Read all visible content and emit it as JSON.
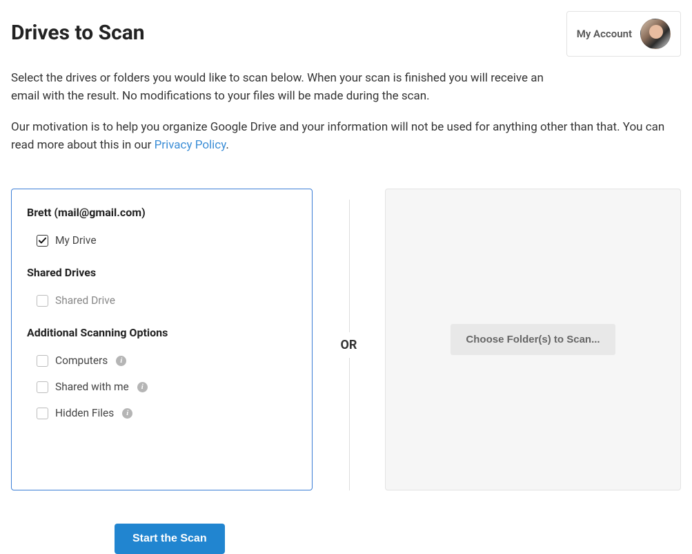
{
  "header": {
    "title": "Drives to Scan",
    "account_label": "My Account"
  },
  "intro": {
    "paragraph1": "Select the drives or folders you would like to scan below. When your scan is finished you will receive an email with the result. No modifications to your files will be made during the scan.",
    "paragraph2_prefix": "Our motivation is to help you organize Google Drive and your information will not be used for anything other than that. You can read more about this in our ",
    "privacy_link": "Privacy Policy",
    "paragraph2_suffix": "."
  },
  "left_panel": {
    "account_name": "Brett (mail@gmail.com)",
    "my_drive": {
      "label": "My Drive",
      "checked": true
    },
    "shared_drives_title": "Shared Drives",
    "shared_drive": {
      "label": "Shared Drive",
      "checked": false
    },
    "additional_title": "Additional Scanning Options",
    "options": [
      {
        "label": "Computers",
        "checked": false,
        "info": true
      },
      {
        "label": "Shared with me",
        "checked": false,
        "info": true
      },
      {
        "label": "Hidden Files",
        "checked": false,
        "info": true
      }
    ]
  },
  "separator": {
    "or": "OR"
  },
  "right_panel": {
    "choose_button": "Choose Folder(s) to Scan..."
  },
  "actions": {
    "start_scan": "Start the Scan"
  }
}
